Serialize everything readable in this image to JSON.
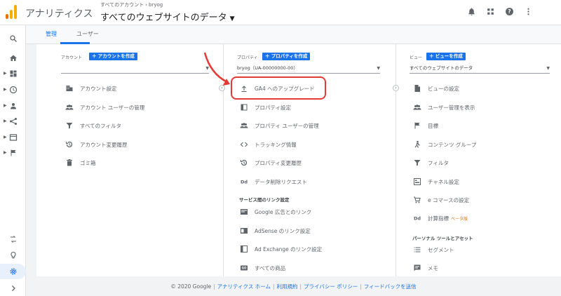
{
  "app": {
    "title": "アナリティクス",
    "breadcrumb": {
      "parent": "すべてのアカウント",
      "child": "bryog"
    },
    "view_title": "すべてのウェブサイトのデータ",
    "icons": [
      "notifications-icon",
      "apps-icon",
      "help-icon",
      "more-vert-icon"
    ]
  },
  "tabs": [
    {
      "label": "管理",
      "active": true
    },
    {
      "label": "ユーザー",
      "active": false
    }
  ],
  "account": {
    "label": "アカウント",
    "create_label": "アカウントを作成",
    "items": [
      {
        "label": "アカウント設定",
        "icon": "building-icon"
      },
      {
        "label": "アカウント ユーザーの管理",
        "icon": "people-icon"
      },
      {
        "label": "すべてのフィルタ",
        "icon": "filter-icon"
      },
      {
        "label": "アカウント変更履歴",
        "icon": "history-icon"
      },
      {
        "label": "ゴミ箱",
        "icon": "trash-icon"
      }
    ]
  },
  "property": {
    "label": "プロパティ",
    "create_label": "プロパティを作成",
    "selected": "bryog（UA-00000000-00）",
    "items": [
      {
        "label": "GA4 へのアップグレード",
        "icon": "upload-icon"
      },
      {
        "label": "プロパティ設定",
        "icon": "settings-square-icon"
      },
      {
        "label": "プロパティ ユーザーの管理",
        "icon": "people-icon"
      },
      {
        "label": "トラッキング情報",
        "icon": "code-icon"
      },
      {
        "label": "プロパティ変更履歴",
        "icon": "history-icon"
      },
      {
        "label": "データ削除リクエスト",
        "icon": "dd-icon"
      }
    ],
    "links_section": "サービス間のリンク設定",
    "link_items": [
      {
        "label": "Google 広告とのリンク",
        "icon": "ads-icon"
      },
      {
        "label": "AdSense のリンク設定",
        "icon": "adsense-icon"
      },
      {
        "label": "Ad Exchange のリンク設定",
        "icon": "adexchange-icon"
      },
      {
        "label": "すべての商品",
        "icon": "products-icon"
      }
    ]
  },
  "view": {
    "label": "ビュー",
    "create_label": "ビューを作成",
    "selected": "すべてのウェブサイトのデータ",
    "items": [
      {
        "label": "ビューの設定",
        "icon": "doc-icon"
      },
      {
        "label": "ユーザー管理を表示",
        "icon": "people-icon"
      },
      {
        "label": "目標",
        "icon": "flag-icon"
      },
      {
        "label": "コンテンツ グループ",
        "icon": "person-walk-icon"
      },
      {
        "label": "フィルタ",
        "icon": "filter-icon"
      },
      {
        "label": "チャネル設定",
        "icon": "channel-icon"
      },
      {
        "label": "e コマースの設定",
        "icon": "cart-icon"
      },
      {
        "label": "計算指標",
        "icon": "dd-icon",
        "badge": "ベータ版"
      }
    ],
    "assets_section": "パーソナル ツールとアセット",
    "asset_items": [
      {
        "label": "セグメント",
        "icon": "segment-icon"
      },
      {
        "label": "メモ",
        "icon": "note-icon"
      }
    ]
  },
  "footer": {
    "copyright": "© 2020 Google",
    "links": [
      "アナリティクス ホーム",
      "利用規約",
      "プライバシー ポリシー",
      "フィードバックを送信"
    ]
  },
  "colors": {
    "accent": "#1a73e8",
    "highlight": "#e53935",
    "logo_orange": "#f9ab00",
    "logo_dark": "#e37400"
  }
}
